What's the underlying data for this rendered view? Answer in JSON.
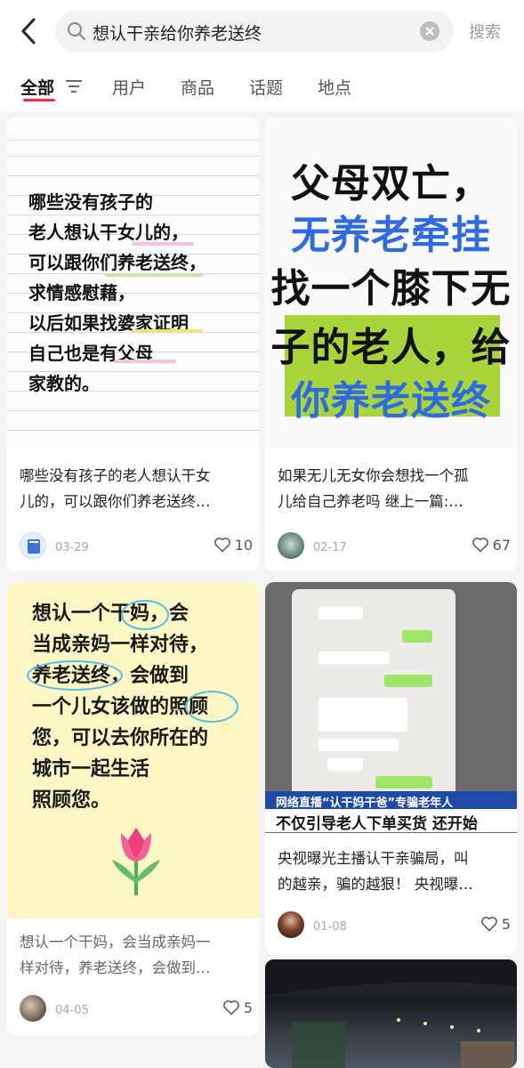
{
  "search": {
    "query": "想认干亲给你养老送终",
    "action": "搜索"
  },
  "tabs": [
    {
      "label": "全部",
      "active": true
    },
    {
      "label": "用户"
    },
    {
      "label": "商品"
    },
    {
      "label": "话题"
    },
    {
      "label": "地点"
    }
  ],
  "colors": {
    "accent": "#ff2442",
    "green_block": "#a9d43b",
    "blue_text": "#2f6be0",
    "yellow_bg": "#fdf7c6",
    "news_blue": "#1f4aa8"
  },
  "icons": {
    "back": "chevron-left-icon",
    "search": "search-icon",
    "clear": "close-circle-icon",
    "filter": "filter-icon",
    "like": "heart-icon"
  },
  "posts": [
    {
      "image_lines": [
        "哪些没有孩子的",
        "老人想认干女儿的，",
        "可以跟你们养老送终，",
        "求情感慰藉，",
        "以后如果找婆家证明",
        "自己也是有父母",
        "家教的。"
      ],
      "title_lines": [
        "哪些没有孩子的老人想认干女",
        "儿的，可以跟你们养老送终…"
      ],
      "date": "03-29",
      "likes": "10"
    },
    {
      "image_lines": [
        "父母双亡，",
        "无养老牵挂",
        "找一个膝下无",
        "子的老人，给",
        "你养老送终"
      ],
      "title_lines": [
        "如果无儿无女你会想找一个孤",
        "儿给自己养老吗 继上一篇:…"
      ],
      "date": "02-17",
      "likes": "67"
    },
    {
      "image_lines": [
        "想认一个干妈，会",
        "当成亲妈一样对待，",
        "养老送终，会做到",
        "一个儿女该做的照顾",
        "您，可以去你所在的",
        "城市一起生活",
        "照顾您。"
      ],
      "title_lines": [
        "想认一个干妈，会当成亲妈一",
        "样对待，养老送终，会做到…"
      ],
      "date": "04-05",
      "likes": "5"
    },
    {
      "image_banner_top": "网络直播“认干妈干爸”专骗老年人",
      "image_banner_bottom": "不仅引导老人下单买货 还开始",
      "title_lines": [
        "央视曝光主播认干亲骗局，叫",
        "的越亲，骗的越狠！ 央视曝…"
      ],
      "date": "01-08",
      "likes": "5"
    }
  ]
}
